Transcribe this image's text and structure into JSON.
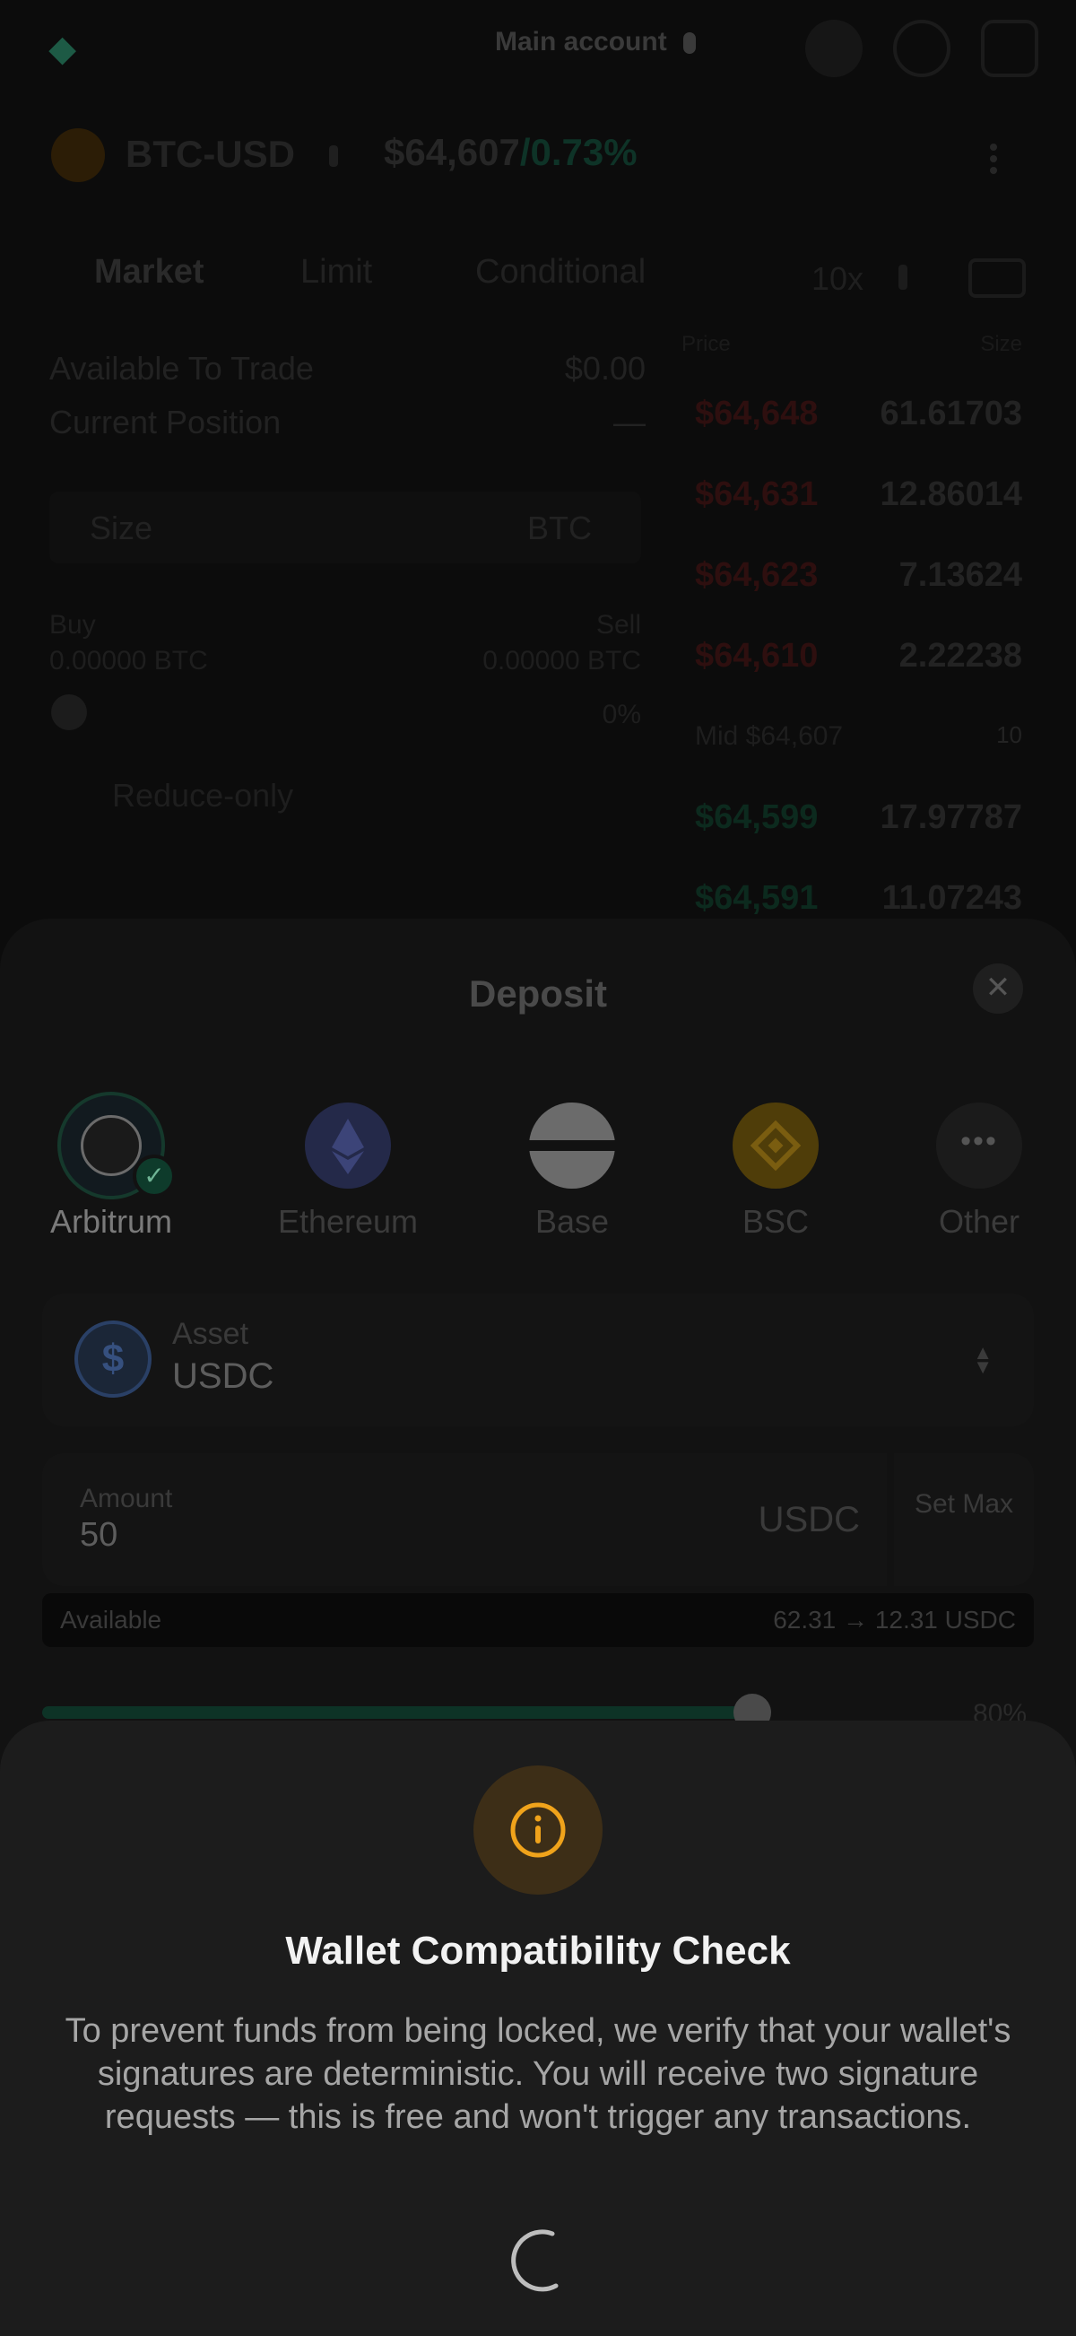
{
  "top_bar": {
    "account_label": "Main account"
  },
  "pair": {
    "symbol": "BTC-USD",
    "price": "$64,607",
    "change": "/0.73%"
  },
  "order_tabs": {
    "market": "Market",
    "limit": "Limit",
    "conditional": "Conditional",
    "size_unit": "10x"
  },
  "order_form": {
    "available_label": "Available To Trade",
    "available_value": "$0.00",
    "position_label": "Current Position",
    "position_value": "—",
    "size_label": "Size",
    "size_unit": "BTC",
    "buy_label": "Buy",
    "buy_value": "0.00000 BTC",
    "sell_label": "Sell",
    "sell_value": "0.00000 BTC",
    "pct": "0%",
    "reduce_only": "Reduce-only"
  },
  "order_book": {
    "header_price": "Price",
    "header_size": "Size",
    "asks": [
      {
        "price": "$64,648",
        "size": "61.61703"
      },
      {
        "price": "$64,631",
        "size": "12.86014"
      },
      {
        "price": "$64,623",
        "size": "7.13624"
      },
      {
        "price": "$64,610",
        "size": "2.22238"
      }
    ],
    "mark": {
      "price": "Mid $64,607",
      "size": "10"
    },
    "bids": [
      {
        "price": "$64,599",
        "size": "17.97787"
      },
      {
        "price": "$64,591",
        "size": "11.07243"
      }
    ]
  },
  "deposit": {
    "title": "Deposit",
    "close_glyph": "✕",
    "chains": [
      {
        "name": "Arbitrum",
        "selected": true
      },
      {
        "name": "Ethereum",
        "selected": false
      },
      {
        "name": "Base",
        "selected": false
      },
      {
        "name": "BSC",
        "selected": false
      },
      {
        "name": "Other",
        "selected": false
      }
    ],
    "asset_label": "Asset",
    "asset_value": "USDC",
    "amount_label": "Amount",
    "amount_value": "50",
    "amount_unit": "USDC",
    "set_max": "Set Max",
    "available_label": "Available",
    "available_value": "62.31 → 12.31 USDC",
    "slider_pct": "80%",
    "slider_fraction": 0.8
  },
  "wallet_check": {
    "title": "Wallet Compatibility Check",
    "body": "To prevent funds from being locked, we verify that your wallet's signatures are deterministic. You will receive two signature requests — this is free and won't trigger any transactions.",
    "icon": "info-icon",
    "accent": "#f0a31b",
    "status": "loading-spinner"
  },
  "colors": {
    "accent_green": "#1f9f6e",
    "warning": "#f0a31b",
    "sheet_bg": "#1c1c1c"
  }
}
